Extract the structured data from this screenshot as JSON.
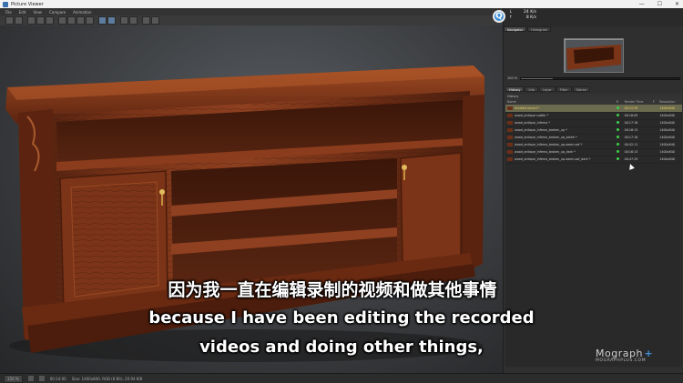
{
  "window": {
    "title": "Picture Viewer",
    "controls": [
      "—",
      "☐",
      "✕"
    ]
  },
  "menu": [
    "File",
    "Edit",
    "View",
    "Compare",
    "Animation"
  ],
  "status": {
    "zoom": "150 %",
    "time": "00:14:00",
    "info": "Size: 1400x840, RGB (8 Bit), 20.94 KiB"
  },
  "network": {
    "badge": "Q",
    "down_value": "24 K/s",
    "up_value": "8 K/s"
  },
  "navigator": {
    "tabs": [
      "Navigator",
      "Histogram"
    ],
    "zoom_label": "100 %",
    "zoom_fraction": 0.2
  },
  "panel_tabs": [
    "History",
    "Info",
    "Layer",
    "Filter",
    "Stereo"
  ],
  "history": {
    "title": "History",
    "columns": [
      "Name",
      "R",
      "Render Time",
      "F",
      "Resolution"
    ],
    "rows": [
      {
        "name": "Untitled record *",
        "time": "00:15:39",
        "res": "1400x840",
        "selected": true
      },
      {
        "name": "wood_antique subtle *",
        "time": "00:16:09",
        "res": "1400x840",
        "selected": false
      },
      {
        "name": "wood_antique_inferno *",
        "time": "00:17:16",
        "res": "1400x840",
        "selected": false
      },
      {
        "name": "wood_antique_inferno_broken_up *",
        "time": "00:16:13",
        "res": "1400x840",
        "selected": false
      },
      {
        "name": "wood_antique_inferno_broken_up_blahe *",
        "time": "00:17:16",
        "res": "1400x840",
        "selected": false
      },
      {
        "name": "wood_antique_inferno_broken_up-warm-sof *",
        "time": "00:42:11",
        "res": "1400x840",
        "selected": false
      },
      {
        "name": "wood_antique_inferno_broken_up_dark *",
        "time": "00:16:13",
        "res": "1400x840",
        "selected": false
      },
      {
        "name": "wood_antique_inferno_broken_up-warm-sof_dark *",
        "time": "00:47:29",
        "res": "1400x840",
        "selected": false
      }
    ]
  },
  "logo": {
    "name": "Mograph",
    "plus": "+",
    "sub": "MOGRAPHPLUS.COM"
  },
  "subtitles": {
    "zh": "因为我一直在编辑录制的视频和做其他事情",
    "en1": "because I have been editing the recorded",
    "en2": "videos and doing other things,"
  },
  "colors": {
    "accent": "#3d8fd6",
    "selected_row": "#6a6a4f",
    "status_ok": "#3ecf4a",
    "wood": "#6b2f18"
  }
}
